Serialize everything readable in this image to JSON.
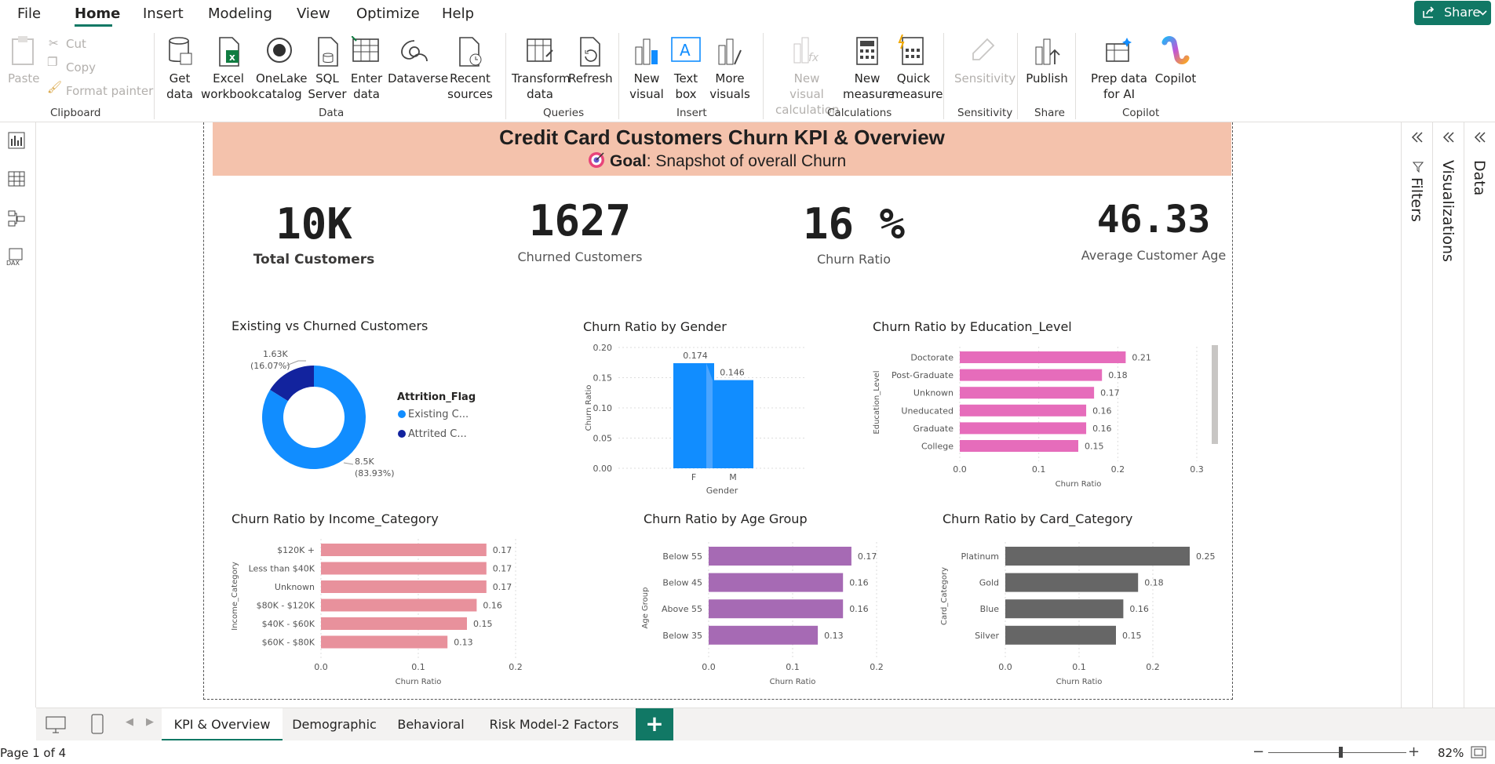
{
  "menu": {
    "file": "File",
    "home": "Home",
    "insert": "Insert",
    "modeling": "Modeling",
    "view": "View",
    "optimize": "Optimize",
    "help": "Help"
  },
  "share_label": "Share",
  "ribbon": {
    "clipboard": {
      "paste": "Paste",
      "cut": "Cut",
      "copy": "Copy",
      "format_painter": "Format painter",
      "group": "Clipboard"
    },
    "data": {
      "get_data": "Get data",
      "excel": "Excel workbook",
      "onelake": "OneLake catalog",
      "sql": "SQL Server",
      "enter": "Enter data",
      "dataverse": "Dataverse",
      "recent": "Recent sources",
      "group": "Data"
    },
    "queries": {
      "transform": "Transform data",
      "refresh": "Refresh",
      "group": "Queries"
    },
    "insert": {
      "new_visual": "New visual",
      "text_box": "Text box",
      "more_visuals": "More visuals",
      "group": "Insert"
    },
    "calculations": {
      "new_visual_calc": "New visual calculation",
      "new_measure": "New measure",
      "quick_measure": "Quick measure",
      "group": "Calculations"
    },
    "sensitivity": {
      "sensitivity": "Sensitivity",
      "group": "Sensitivity"
    },
    "share": {
      "publish": "Publish",
      "group": "Share"
    },
    "copilot": {
      "prep": "Prep data for AI",
      "copilot": "Copilot",
      "group": "Copilot"
    }
  },
  "report": {
    "title": "Credit Card Customers Churn KPI & Overview",
    "goal_label": "Goal",
    "goal_text": ": Snapshot of overall Churn",
    "kpis": [
      {
        "value": "10K",
        "label": "Total Customers"
      },
      {
        "value": "1627",
        "label": "Churned Customers"
      },
      {
        "value": "16 %",
        "label": "Churn Ratio"
      },
      {
        "value": "46.33",
        "label": "Average Customer Age"
      }
    ]
  },
  "chart_data": [
    {
      "type": "pie",
      "title": "Existing vs Churned Customers",
      "legend_title": "Attrition_Flag",
      "legend": [
        "Existing C...",
        "Attrited C..."
      ],
      "values": [
        8500,
        1630
      ],
      "labels": [
        {
          "value": "8.5K",
          "pct": "(83.93%)"
        },
        {
          "value": "1.63K",
          "pct": "(16.07%)"
        }
      ],
      "colors": [
        "#118dff",
        "#12239e"
      ]
    },
    {
      "type": "bar",
      "title": "Churn Ratio by Gender",
      "categories": [
        "F",
        "M"
      ],
      "values": [
        0.174,
        0.146
      ],
      "value_labels": [
        "0.174",
        "0.146"
      ],
      "xlabel": "Gender",
      "ylabel": "Churn Ratio",
      "ylim": [
        0,
        0.2
      ],
      "yticks": [
        "0.20",
        "0.15",
        "0.10",
        "0.05",
        "0.00"
      ],
      "color": "#118dff"
    },
    {
      "type": "bar",
      "title": "Churn Ratio by Education_Level",
      "orientation": "horizontal",
      "categories": [
        "Doctorate",
        "Post-Graduate",
        "Unknown",
        "Uneducated",
        "Graduate",
        "College"
      ],
      "values": [
        0.21,
        0.18,
        0.17,
        0.16,
        0.16,
        0.15
      ],
      "value_labels": [
        "0.21",
        "0.18",
        "0.17",
        "0.16",
        "0.16",
        "0.15"
      ],
      "xlabel": "Churn Ratio",
      "ylabel": "Education_Level",
      "xlim": [
        0,
        0.3
      ],
      "xticks": [
        "0.0",
        "0.1",
        "0.2",
        "0.3"
      ],
      "color": "#e66c b9"
    },
    {
      "type": "bar",
      "title": "Churn Ratio by Income_Category",
      "orientation": "horizontal",
      "categories": [
        "$120K +",
        "Less than $40K",
        "Unknown",
        "$80K - $120K",
        "$40K - $60K",
        "$60K - $80K"
      ],
      "values": [
        0.17,
        0.17,
        0.17,
        0.16,
        0.15,
        0.13
      ],
      "value_labels": [
        "0.17",
        "0.17",
        "0.17",
        "0.16",
        "0.15",
        "0.13"
      ],
      "xlabel": "Churn Ratio",
      "ylabel": "Income_Category",
      "xlim": [
        0,
        0.2
      ],
      "xticks": [
        "0.0",
        "0.1",
        "0.2"
      ],
      "color": "#e8919c"
    },
    {
      "type": "bar",
      "title": "Churn Ratio by Age Group",
      "orientation": "horizontal",
      "categories": [
        "Below 55",
        "Below 45",
        "Above 55",
        "Below 35"
      ],
      "values": [
        0.17,
        0.16,
        0.16,
        0.13
      ],
      "value_labels": [
        "0.17",
        "0.16",
        "0.16",
        "0.13"
      ],
      "xlabel": "Churn Ratio",
      "ylabel": "Age Group",
      "xlim": [
        0,
        0.2
      ],
      "xticks": [
        "0.0",
        "0.1",
        "0.2"
      ],
      "color": "#a66ab4"
    },
    {
      "type": "bar",
      "title": "Churn Ratio by Card_Category",
      "orientation": "horizontal",
      "categories": [
        "Platinum",
        "Gold",
        "Blue",
        "Silver"
      ],
      "values": [
        0.25,
        0.18,
        0.16,
        0.15
      ],
      "value_labels": [
        "0.25",
        "0.18",
        "0.16",
        "0.15"
      ],
      "xlabel": "Churn Ratio",
      "ylabel": "Card_Category",
      "xlim": [
        0,
        0.2
      ],
      "xticks": [
        "0.0",
        "0.1",
        "0.2"
      ],
      "color": "#666666"
    }
  ],
  "panes": {
    "filters": "Filters",
    "visualizations": "Visualizations",
    "data": "Data"
  },
  "tabs": [
    "KPI & Overview",
    "Demographic",
    "Behavioral",
    "Risk Model-2 Factors"
  ],
  "status": {
    "page": "Page 1 of 4",
    "zoom": "82%"
  }
}
